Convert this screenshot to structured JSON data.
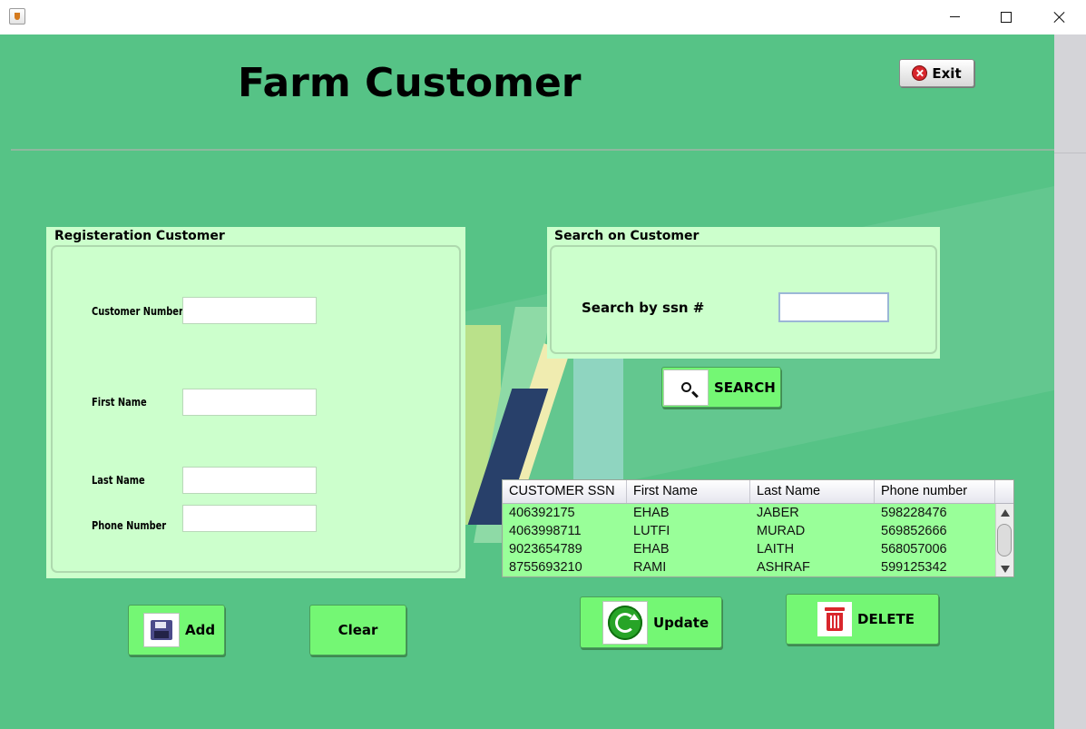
{
  "window": {
    "title": "",
    "controls": [
      "minimize",
      "maximize",
      "close"
    ]
  },
  "header": {
    "title": "Farm Customer",
    "exit_label": "Exit",
    "exit_icon": "close-circle-icon"
  },
  "registration": {
    "title": "Registeration Customer",
    "fields": [
      {
        "label": "Customer Number",
        "value": ""
      },
      {
        "label": "First Name",
        "value": ""
      },
      {
        "label": "Last Name",
        "value": ""
      },
      {
        "label": "Phone Number",
        "value": ""
      }
    ]
  },
  "search": {
    "title": "Search on Customer",
    "label": "Search by ssn #",
    "value": "",
    "button_label": "SEARCH",
    "button_icon": "magnifier-icon"
  },
  "table": {
    "columns": [
      "CUSTOMER SSN",
      "First Name",
      "Last Name",
      "Phone number"
    ],
    "rows": [
      [
        "406392175",
        "EHAB",
        "JABER",
        "598228476"
      ],
      [
        "4063998711",
        "LUTFI",
        "MURAD",
        "569852666"
      ],
      [
        "9023654789",
        "EHAB",
        "LAITH",
        "568057006"
      ],
      [
        "8755693210",
        "RAMI",
        "ASHRAF",
        "599125342"
      ]
    ]
  },
  "actions": {
    "add_label": "Add",
    "add_icon": "floppy-disk-icon",
    "clear_label": "Clear",
    "update_label": "Update",
    "update_icon": "refresh-icon",
    "delete_label": "DELETE",
    "delete_icon": "trash-icon"
  },
  "colors": {
    "background": "#56c386",
    "panel": "#ccffcc",
    "button": "#74f774",
    "table_rows": "#99ff99"
  }
}
